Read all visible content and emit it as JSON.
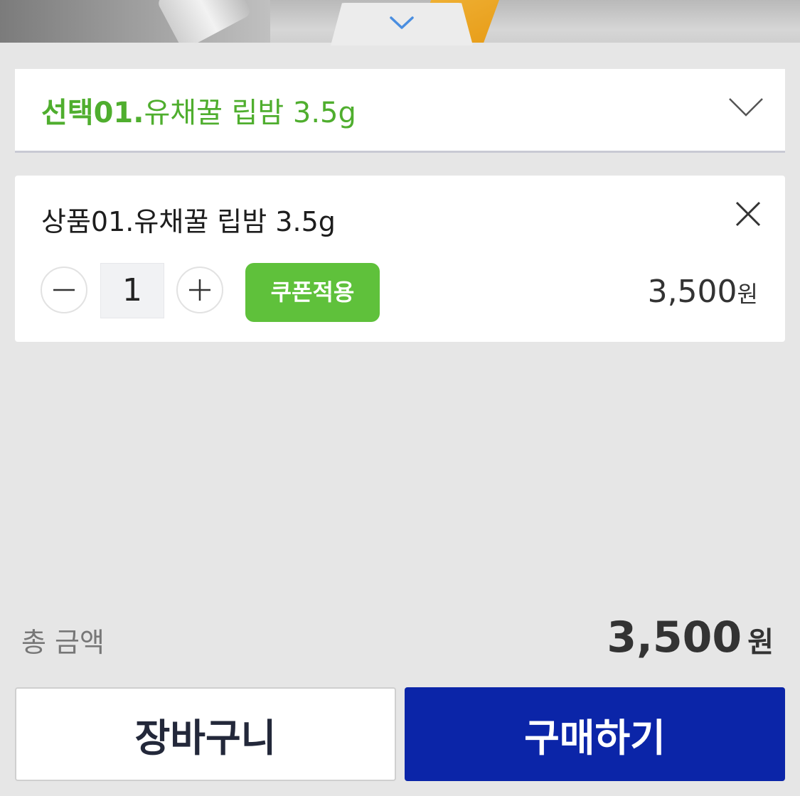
{
  "option_select": {
    "prefix": "선택01.",
    "value": "유채꿀 립밤 3.5g"
  },
  "item": {
    "title": "상품01.유채꿀 립밤 3.5g",
    "quantity": "1",
    "coupon_label": "쿠폰적용",
    "price": "3,500",
    "price_unit": "원"
  },
  "total": {
    "label": "총 금액",
    "amount": "3,500",
    "unit": "원"
  },
  "actions": {
    "cart_label": "장바구니",
    "buy_label": "구매하기"
  },
  "colors": {
    "accent_green": "#5fc13b",
    "option_green": "#4fae2e",
    "buy_blue": "#0b25a8",
    "handle_chevron": "#4a8ee0"
  },
  "icons": [
    "chevron-down-icon",
    "close-icon",
    "minus-icon",
    "plus-icon"
  ]
}
